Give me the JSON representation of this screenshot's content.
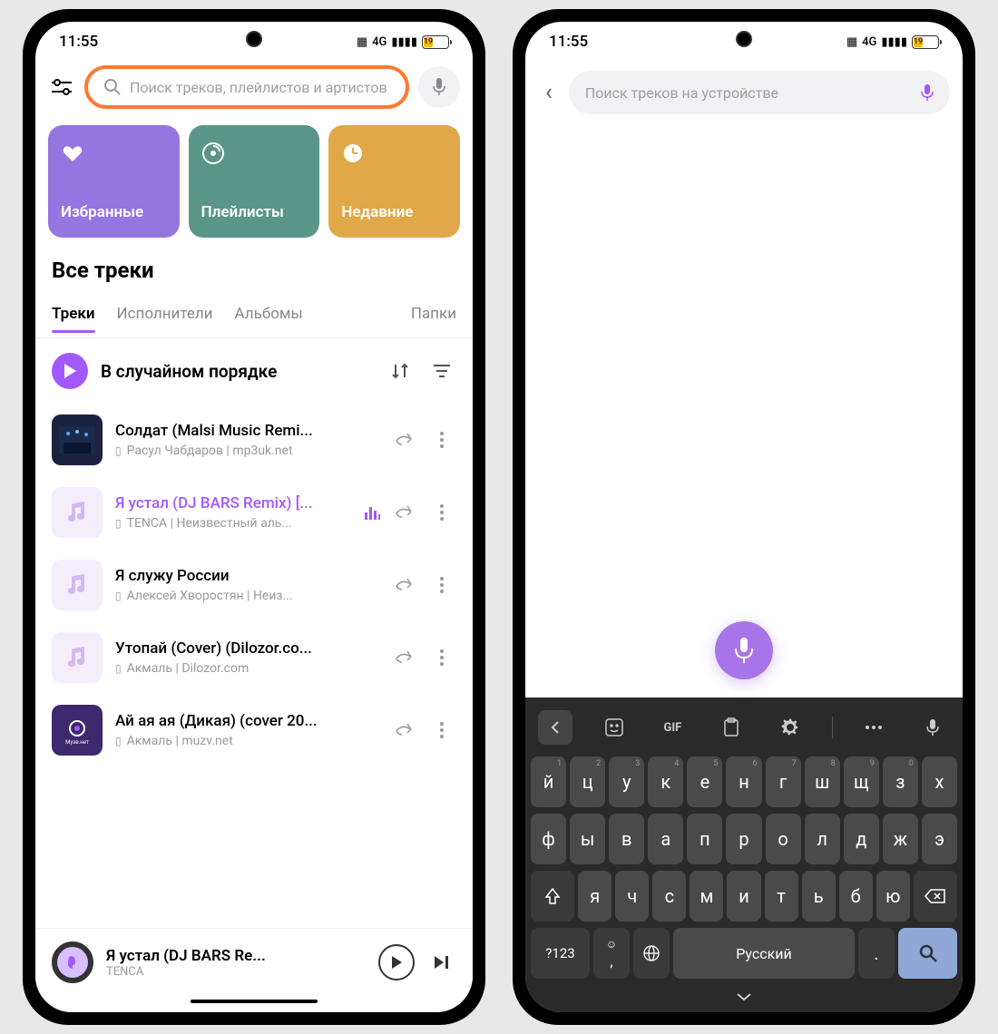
{
  "status": {
    "time": "11:55",
    "battery": "19",
    "network": "4G"
  },
  "phone1": {
    "search_placeholder": "Поиск треков, плейлистов и артистов",
    "cards": {
      "fav": "Избранные",
      "play": "Плейлисты",
      "recent": "Недавние"
    },
    "section": "Все треки",
    "tabs": {
      "tracks": "Треки",
      "artists": "Исполнители",
      "albums": "Альбомы",
      "folders": "Папки"
    },
    "shuffle": "В случайном порядке",
    "tracks": [
      {
        "title": "Солдат (Malsi Music Remi...",
        "meta": "Расул Чабдаров | mp3uk.net"
      },
      {
        "title": "Я устал (DJ BARS Remix) [...",
        "meta": "TENCA | Неизвестный аль..."
      },
      {
        "title": "Я служу России",
        "meta": "Алексей Хворостян | Неиз..."
      },
      {
        "title": "Утопай (Cover) (Dilozor.co...",
        "meta": "Акмаль | Dilozor.com"
      },
      {
        "title": "Ай ая ая (Дикая) (cover 20...",
        "meta": "Акмаль | muzv.net"
      }
    ],
    "now_playing": {
      "title": "Я устал (DJ BARS Re...",
      "artist": "TENCA"
    }
  },
  "phone2": {
    "search_placeholder": "Поиск треков на устройстве",
    "keyboard": {
      "gif": "GIF",
      "row1": [
        [
          "й",
          "1"
        ],
        [
          "ц",
          "2"
        ],
        [
          "у",
          "3"
        ],
        [
          "к",
          "4"
        ],
        [
          "е",
          "5"
        ],
        [
          "н",
          "6"
        ],
        [
          "г",
          "7"
        ],
        [
          "ш",
          "8"
        ],
        [
          "щ",
          "9"
        ],
        [
          "з",
          "0"
        ],
        [
          "х",
          ""
        ]
      ],
      "row2": [
        "ф",
        "ы",
        "в",
        "а",
        "п",
        "р",
        "о",
        "л",
        "д",
        "ж",
        "э"
      ],
      "row3": [
        "я",
        "ч",
        "с",
        "м",
        "и",
        "т",
        "ь",
        "б",
        "ю"
      ],
      "switch": "?123",
      "space": "Русский",
      "period": "."
    }
  }
}
